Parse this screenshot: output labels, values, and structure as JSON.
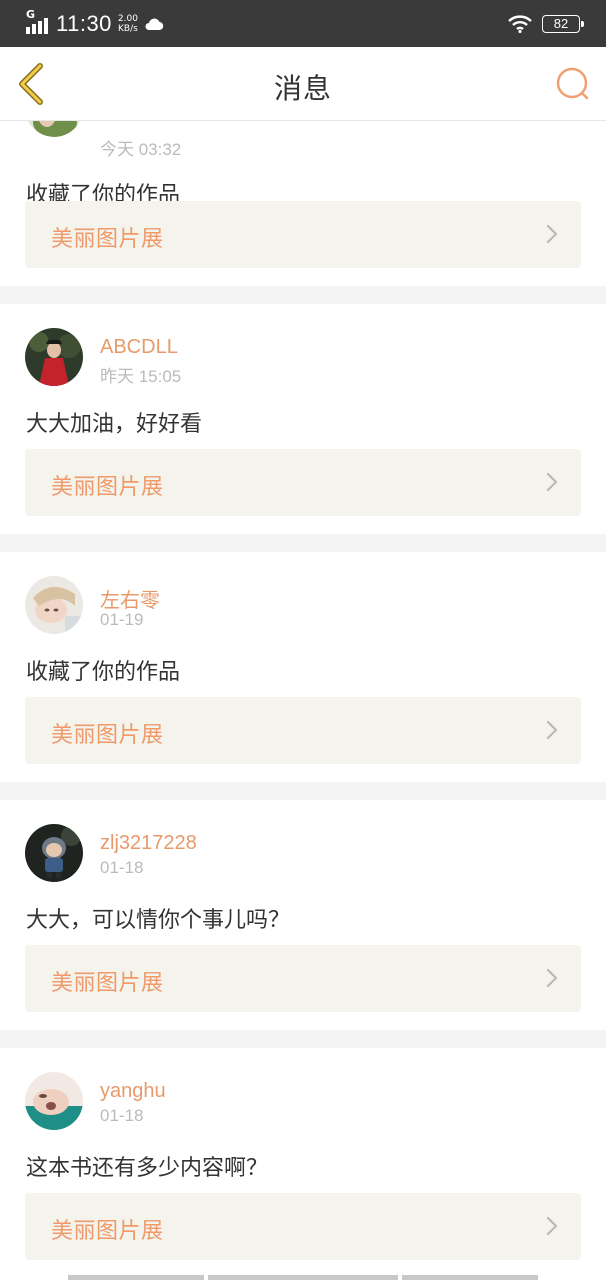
{
  "status_bar": {
    "network_type": "G",
    "time": "11:30",
    "speed_value": "2.00",
    "speed_unit": "KB/s",
    "battery": "82"
  },
  "header": {
    "title": "消息",
    "back_icon": "chevron-left-icon",
    "search_icon": "search-icon"
  },
  "colors": {
    "accent": "#ee9a6a",
    "username": "#e89a6b",
    "back_icon": "#e2b63a",
    "ref_background": "#f5f4ec"
  },
  "messages": [
    {
      "username": "",
      "time": "今天 03:32",
      "text": "收藏了你的作品",
      "ref_title": "美丽图片展"
    },
    {
      "username": "ABCDLL",
      "time": "昨天 15:05",
      "text": "大大加油，好好看",
      "ref_title": "美丽图片展"
    },
    {
      "username": "左右零",
      "time": "01-19",
      "text": "收藏了你的作品",
      "ref_title": "美丽图片展"
    },
    {
      "username": "zlj3217228",
      "time": "01-18",
      "text": "大大，可以情你个事儿吗？",
      "ref_title": "美丽图片展"
    },
    {
      "username": "yanghu",
      "time": "01-18",
      "text": "这本书还有多少内容啊？",
      "ref_title": "美丽图片展"
    }
  ]
}
